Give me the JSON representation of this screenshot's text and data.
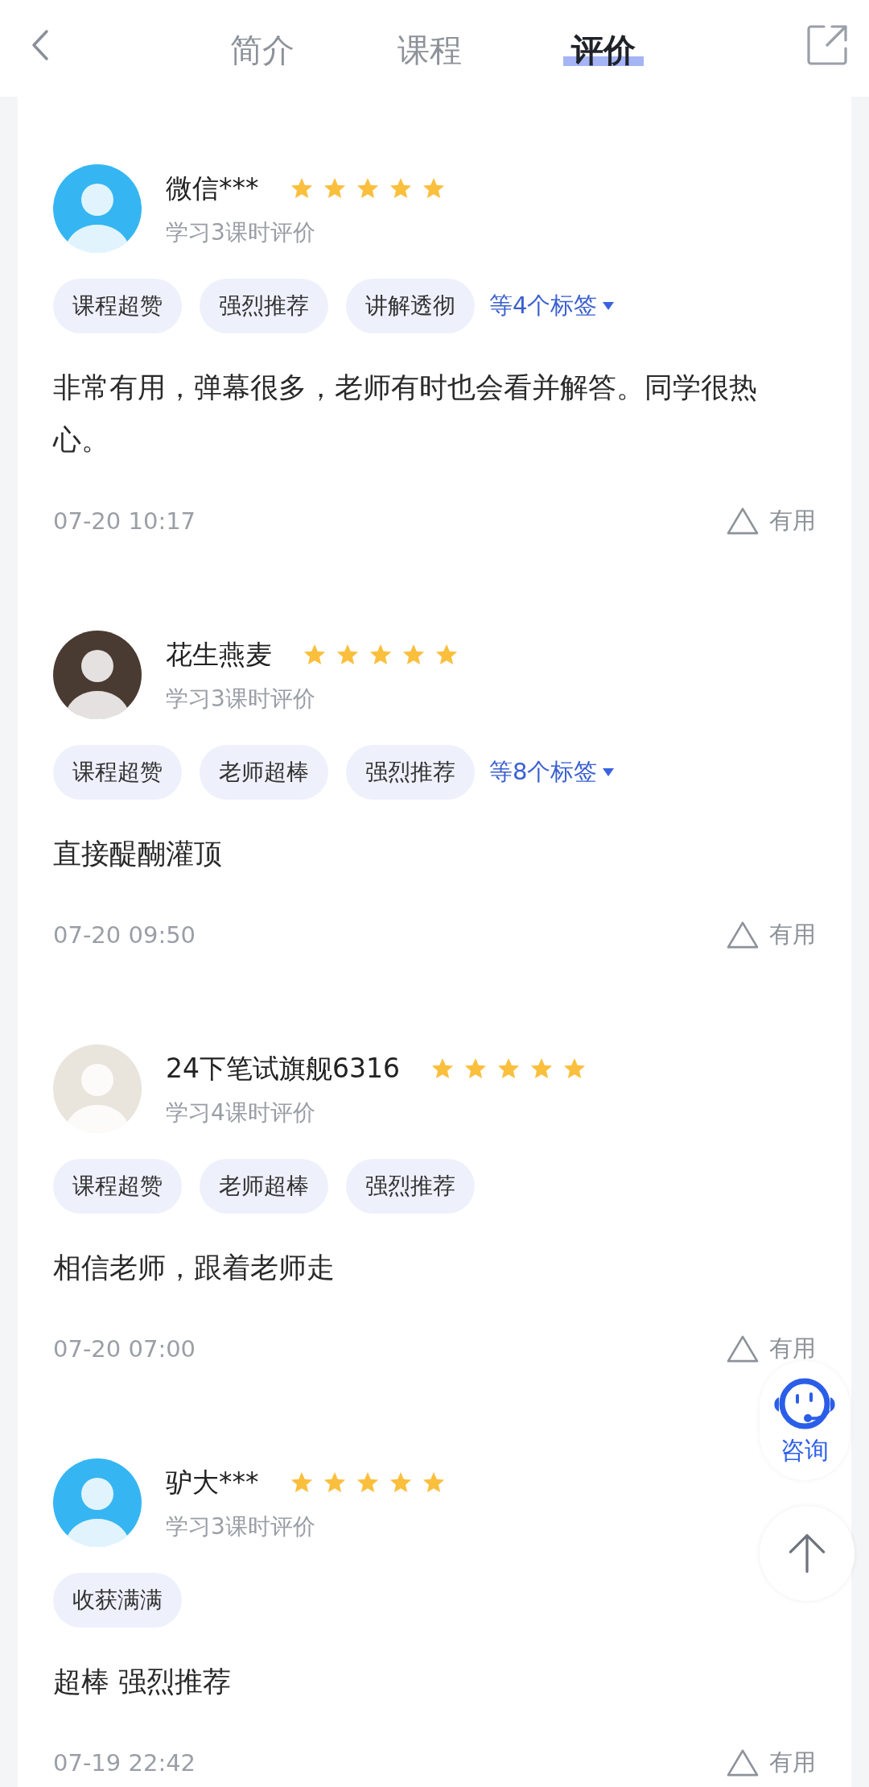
{
  "header": {
    "tabs": [
      {
        "label": "简介",
        "selected": false
      },
      {
        "label": "课程",
        "selected": false
      },
      {
        "label": "评价",
        "selected": true
      }
    ]
  },
  "reviews": [
    {
      "avatar": {
        "color": "#35b6f2"
      },
      "name": "微信***",
      "stars": 5,
      "subtitle": "学习3课时评价",
      "tags": [
        "课程超赞",
        "强烈推荐",
        "讲解透彻"
      ],
      "more_tags": "等4个标签",
      "comment": "非常有用，弹幕很多，老师有时也会看并解答。同学很热心。",
      "date": "07-20 10:17",
      "useful": "有用"
    },
    {
      "avatar": {
        "color": "#4a3b32"
      },
      "name": "花生燕麦",
      "stars": 5,
      "subtitle": "学习3课时评价",
      "tags": [
        "课程超赞",
        "老师超棒",
        "强烈推荐"
      ],
      "more_tags": "等8个标签",
      "comment": "直接醍醐灌顶",
      "date": "07-20 09:50",
      "useful": "有用"
    },
    {
      "avatar": {
        "color": "#e9e4dc"
      },
      "name": "24下笔试旗舰6316",
      "stars": 5,
      "subtitle": "学习4课时评价",
      "tags": [
        "课程超赞",
        "老师超棒",
        "强烈推荐"
      ],
      "comment": "相信老师，跟着老师走",
      "date": "07-20 07:00",
      "useful": "有用"
    },
    {
      "avatar": {
        "color": "#35b6f2"
      },
      "name": "驴大***",
      "stars": 5,
      "subtitle": "学习3课时评价",
      "tags": [
        "收获满满"
      ],
      "comment": "超棒 强烈推荐",
      "date": "07-19 22:42",
      "useful": "有用"
    }
  ],
  "consult": {
    "label": "咨询"
  }
}
